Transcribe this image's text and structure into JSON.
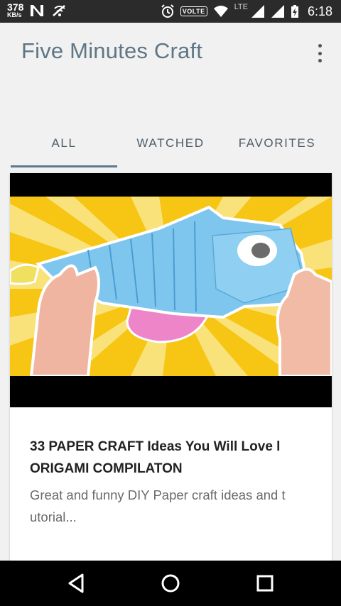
{
  "status_bar": {
    "netspeed_value": "378",
    "netspeed_unit": "KB/s",
    "volte_label": "VOLTE",
    "network_type": "LTE",
    "time": "6:18",
    "icons": [
      "n-notification-icon",
      "signal-off-icon",
      "alarm-icon",
      "volte-icon",
      "wifi-icon",
      "cell-signal-icon",
      "cell-signal-icon",
      "battery-charging-icon"
    ]
  },
  "app_bar": {
    "title": "Five Minutes Craft",
    "overflow_icon": "more-vert-icon"
  },
  "tabs": [
    {
      "label": "ALL",
      "active": true
    },
    {
      "label": "WATCHED",
      "active": false
    },
    {
      "label": "FAVORITES",
      "active": false
    }
  ],
  "card": {
    "title": "33 PAPER CRAFT Ideas You Will Love l ORIGAMI COMPILATON",
    "description": "Great and funny DIY Paper craft ideas and t utorial..."
  },
  "nav_bar": {
    "buttons": [
      "back-icon",
      "home-icon",
      "recents-icon"
    ]
  },
  "colors": {
    "title_color": "#5f7686",
    "tab_indicator": "#5a7a90",
    "status_bar_bg": "#2b2b2b"
  }
}
